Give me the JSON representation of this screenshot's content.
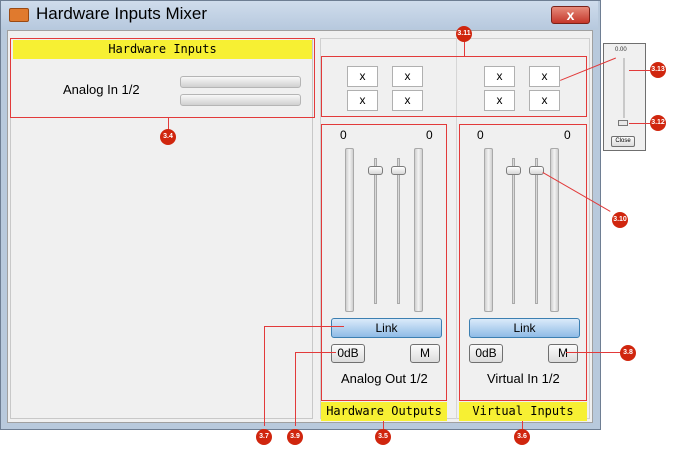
{
  "window": {
    "title": "Hardware Inputs Mixer",
    "close_label": "x"
  },
  "hardware_inputs": {
    "header": "Hardware Inputs",
    "channel_label": "Analog In 1/2"
  },
  "matrix_left": [
    "x",
    "x",
    "x",
    "x"
  ],
  "matrix_right": [
    "x",
    "x",
    "x",
    "x"
  ],
  "analog_out": {
    "left_level": "0",
    "right_level": "0",
    "link_label": "Link",
    "gain_label": "0dB",
    "mute_label": "M",
    "channel_label": "Analog Out 1/2",
    "footer": "Hardware Outputs"
  },
  "virtual_in": {
    "left_level": "0",
    "right_level": "0",
    "link_label": "Link",
    "gain_label": "0dB",
    "mute_label": "M",
    "channel_label": "Virtual In 1/2",
    "footer": "Virtual Inputs"
  },
  "popup": {
    "value": "0.00",
    "close_label": "Close"
  },
  "callouts": [
    "3.4",
    "3.5",
    "3.6",
    "3.7",
    "3.8",
    "3.9",
    "3.10",
    "3.11",
    "3.12",
    "3.13"
  ],
  "colors": {
    "callout": "#d0260e",
    "highlight": "#f7f033",
    "accent": "#3c7fb1"
  }
}
